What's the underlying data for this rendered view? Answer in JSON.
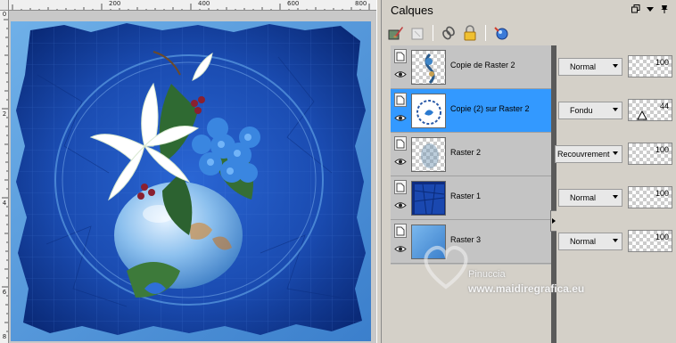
{
  "rulers": {
    "top_ticks": [
      "200",
      "400",
      "600",
      "800"
    ],
    "left_ticks": [
      "0",
      "2",
      "4",
      "6",
      "8"
    ]
  },
  "panel": {
    "title": "Calques",
    "controls": [
      "restore-icon",
      "menu-arrow-icon",
      "pin-icon"
    ]
  },
  "toolbar": {
    "icons": [
      "paint-brush-mask-icon",
      "new-layer-icon",
      "link-icon",
      "lock-icon",
      "effects-sphere-icon"
    ]
  },
  "layers": [
    {
      "name": "Copie de Raster 2",
      "blend": "Normal",
      "opacity": "100",
      "selected": false,
      "thumb": "ornament"
    },
    {
      "name": "Copie (2) sur Raster 2",
      "blend": "Fondu",
      "opacity": "44",
      "selected": true,
      "thumb": "swirl"
    },
    {
      "name": "Raster 2",
      "blend": "Recouvrement",
      "opacity": "100",
      "selected": false,
      "thumb": "faint-blur"
    },
    {
      "name": "Raster 1",
      "blend": "Normal",
      "opacity": "100",
      "selected": false,
      "thumb": "dark-blue-texture"
    },
    {
      "name": "Raster 3",
      "blend": "Normal",
      "opacity": "100",
      "selected": false,
      "thumb": "blue-gradient"
    }
  ],
  "watermark": {
    "name": "Pinuccia",
    "url": "www.maidiregrafica.eu"
  },
  "colors": {
    "selection": "#3399ff",
    "panel_bg": "#d4d0c8",
    "canvas_blue": "#1c4fb0"
  }
}
